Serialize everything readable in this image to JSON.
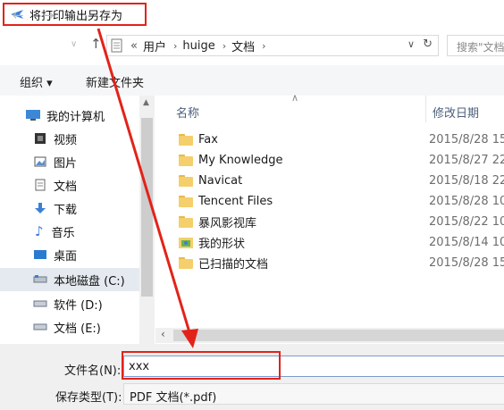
{
  "window": {
    "title": "将打印输出另存为"
  },
  "nav": {
    "back": "←",
    "forward": "→",
    "up": "↑"
  },
  "address": {
    "prefix": "«",
    "crumbs": [
      "用户",
      "huige",
      "文档"
    ],
    "chevron": "›",
    "dropdown": "∨",
    "refresh": "↻"
  },
  "search": {
    "placeholder": "搜索\"文档\""
  },
  "toolbar": {
    "organize": "组织 ▾",
    "new_folder": "新建文件夹"
  },
  "sidebar": {
    "items": [
      {
        "label": "我的计算机",
        "icon": "computer-icon"
      },
      {
        "label": "视频",
        "icon": "video-icon"
      },
      {
        "label": "图片",
        "icon": "pictures-icon"
      },
      {
        "label": "文档",
        "icon": "documents-icon"
      },
      {
        "label": "下载",
        "icon": "download-icon"
      },
      {
        "label": "音乐",
        "icon": "music-icon"
      },
      {
        "label": "桌面",
        "icon": "desktop-icon"
      },
      {
        "label": "本地磁盘 (C:)",
        "icon": "drive-icon",
        "selected": true
      },
      {
        "label": "软件 (D:)",
        "icon": "drive-icon"
      },
      {
        "label": "文档 (E:)",
        "icon": "drive-icon"
      }
    ]
  },
  "file_list": {
    "columns": {
      "name": "名称",
      "date": "修改日期"
    },
    "rows": [
      {
        "name": "Fax",
        "date": "2015/8/28 15",
        "icon": "folder-icon"
      },
      {
        "name": "My Knowledge",
        "date": "2015/8/27 22",
        "icon": "folder-icon"
      },
      {
        "name": "Navicat",
        "date": "2015/8/18 22",
        "icon": "folder-icon"
      },
      {
        "name": "Tencent Files",
        "date": "2015/8/28 10",
        "icon": "folder-icon"
      },
      {
        "name": "暴风影视库",
        "date": "2015/8/22 10",
        "icon": "folder-icon"
      },
      {
        "name": "我的形状",
        "date": "2015/8/14 10",
        "icon": "shapes-folder-icon"
      },
      {
        "name": "已扫描的文档",
        "date": "2015/8/28 15",
        "icon": "folder-icon"
      }
    ]
  },
  "bottom": {
    "filename_label": "文件名(N):",
    "filename_value": "xxx",
    "type_label": "保存类型(T):",
    "type_value": "PDF 文档(*.pdf)"
  },
  "colors": {
    "highlight_red": "#e2231a",
    "accent_blue": "#3c7fd6"
  }
}
